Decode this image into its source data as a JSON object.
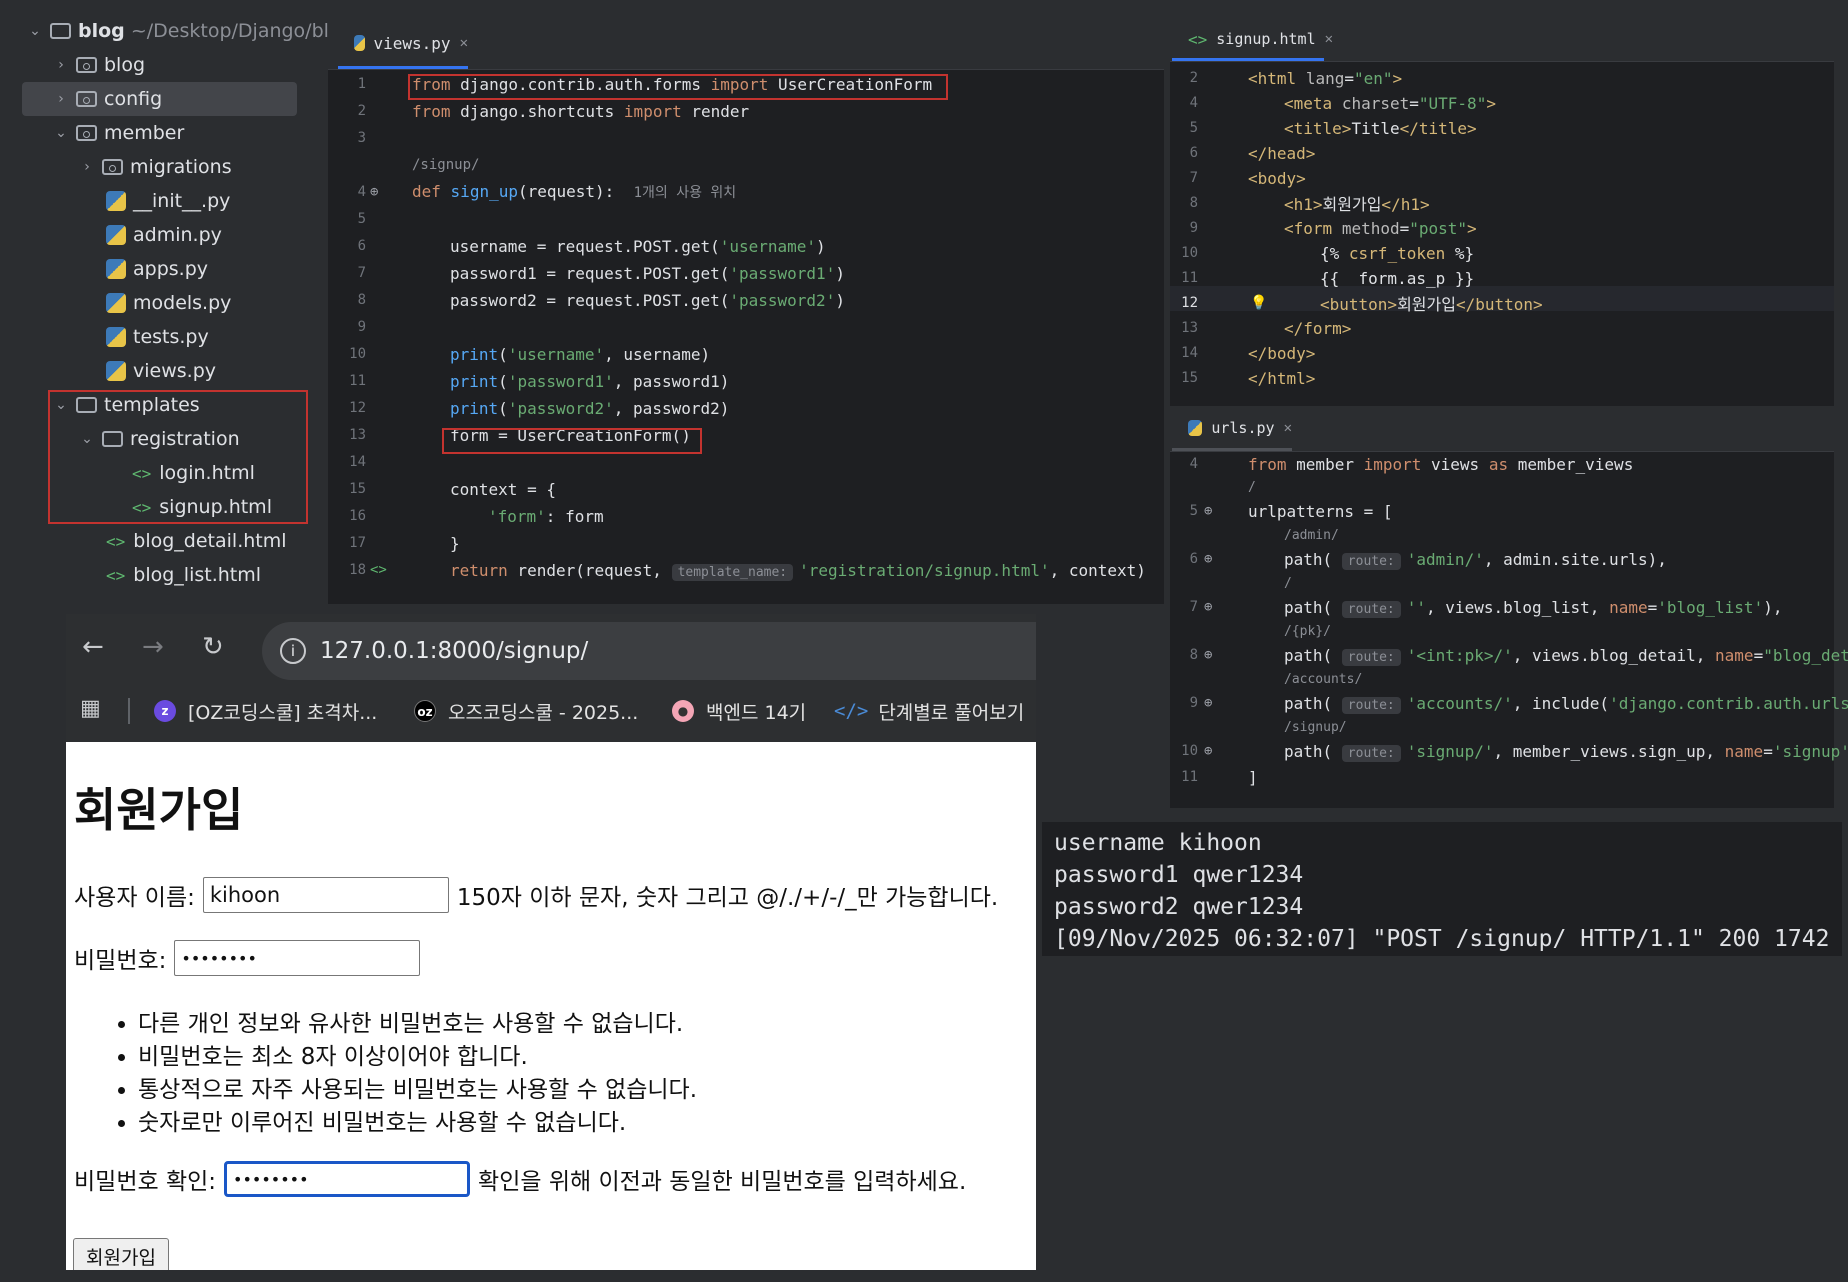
{
  "tree": {
    "root_name": "blog",
    "root_path": "~/Desktop/Django/blo",
    "items": [
      {
        "label": "blog"
      },
      {
        "label": "config"
      },
      {
        "label": "member"
      },
      {
        "label": "migrations"
      },
      {
        "label": "__init__.py"
      },
      {
        "label": "admin.py"
      },
      {
        "label": "apps.py"
      },
      {
        "label": "models.py"
      },
      {
        "label": "tests.py"
      },
      {
        "label": "views.py"
      },
      {
        "label": "templates"
      },
      {
        "label": "registration"
      },
      {
        "label": "login.html"
      },
      {
        "label": "signup.html"
      },
      {
        "label": "blog_detail.html"
      },
      {
        "label": "blog_list.html"
      }
    ]
  },
  "views_editor": {
    "tab": "views.py",
    "lines": {
      "n1": "1",
      "n2": "2",
      "n3": "3",
      "n4": "4",
      "n5": "5",
      "n6": "6",
      "n7": "7",
      "n8": "8",
      "n9": "9",
      "n10": "10",
      "n11": "11",
      "n12": "12",
      "n13": "13",
      "n14": "14",
      "n15": "15",
      "n16": "16",
      "n17": "17",
      "n18": "18",
      "route_hint": "/signup/",
      "usage_hint": "1개의 사용 위치",
      "template_hint": "template_name:"
    }
  },
  "signup_editor": {
    "tab": "signup.html",
    "line_numbers": [
      "2",
      "4",
      "5",
      "6",
      "7",
      "8",
      "9",
      "10",
      "11",
      "12",
      "13",
      "14",
      "15"
    ]
  },
  "urls_editor": {
    "tab": "urls.py",
    "line_numbers": [
      "4",
      "5",
      "6",
      "7",
      "8",
      "9",
      "10",
      "11"
    ],
    "hints": {
      "root": "/",
      "admin": "/admin/",
      "empty": "/",
      "pk": "/{pk}/",
      "accounts": "/accounts/",
      "signup": "/signup/",
      "route": "route:"
    }
  },
  "browser": {
    "url": "127.0.0.1:8000/signup/",
    "bookmarks": [
      "[OZ코딩스쿨] 초격차...",
      "오즈코딩스쿨 - 2025...",
      "백엔드 14기",
      "단계별로 풀어보기"
    ],
    "page": {
      "title": "회원가입",
      "username_label": "사용자 이름:",
      "username_value": "kihoon",
      "username_help": "150자 이하 문자, 숫자 그리고 @/./+/-/_만 가능합니다.",
      "password_label": "비밀번호:",
      "password_value": "••••••••",
      "password_rules": [
        "다른 개인 정보와 유사한 비밀번호는 사용할 수 없습니다.",
        "비밀번호는 최소 8자 이상이어야 합니다.",
        "통상적으로 자주 사용되는 비밀번호는 사용할 수 없습니다.",
        "숫자로만 이루어진 비밀번호는 사용할 수 없습니다."
      ],
      "confirm_label": "비밀번호 확인:",
      "confirm_value": "••••••••",
      "confirm_help": "확인을 위해 이전과 동일한 비밀번호를 입력하세요.",
      "submit_label": "회원가입"
    }
  },
  "terminal": {
    "lines": [
      "username kihoon",
      "password1 qwer1234",
      "password2 qwer1234",
      "[09/Nov/2025 06:32:07] \"POST /signup/ HTTP/1.1\" 200 1742"
    ]
  },
  "colors": {
    "ide_bg": "#1e1f22",
    "keyword": "#cf8e6d",
    "string": "#6aab73",
    "function": "#56a8f5",
    "highlight_box": "#c3332f",
    "focus_border": "#1a57c7"
  }
}
